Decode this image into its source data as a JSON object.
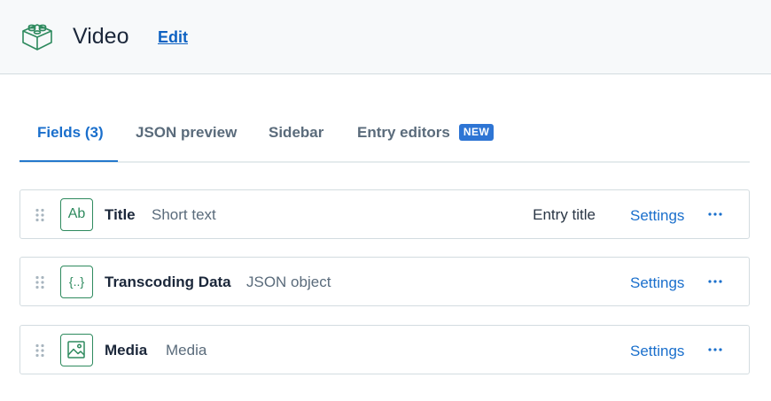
{
  "header": {
    "content_type_name": "Video",
    "edit_label": "Edit",
    "icon": "content-type-block-icon",
    "icon_color": "#2e8a5e"
  },
  "tabs": [
    {
      "label": "Fields (3)",
      "active": true
    },
    {
      "label": "JSON preview",
      "active": false
    },
    {
      "label": "Sidebar",
      "active": false
    },
    {
      "label": "Entry editors",
      "active": false,
      "badge": "NEW"
    }
  ],
  "fields": [
    {
      "name": "Title",
      "type": "Short text",
      "icon_text": "Ab",
      "icon": "text-field-icon",
      "tag": "Entry title",
      "settings_label": "Settings"
    },
    {
      "name": "Transcoding Data",
      "type": "JSON object",
      "icon_text": "{..}",
      "icon": "json-field-icon",
      "tag": "",
      "settings_label": "Settings"
    },
    {
      "name": "Media",
      "type": "Media",
      "icon_text": "",
      "icon": "media-field-icon",
      "tag": "",
      "settings_label": "Settings"
    }
  ],
  "colors": {
    "accent": "#1a6fcc",
    "badge_bg": "#2e75d4",
    "field_icon": "#2e8a5e",
    "header_bg": "#f7f9fa"
  }
}
